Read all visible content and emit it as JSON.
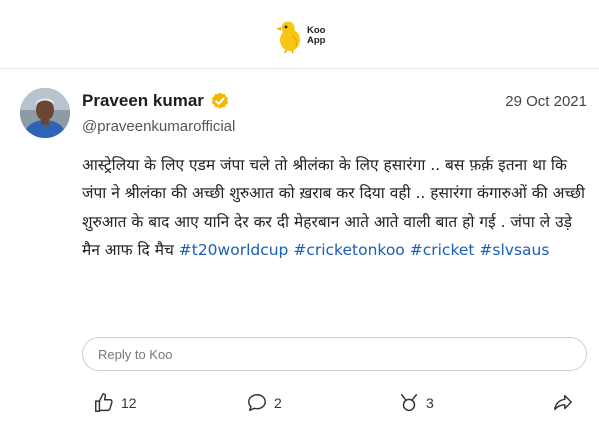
{
  "app": {
    "logo_line1": "Koo",
    "logo_line2": "App",
    "accent_yellow": "#F7C512"
  },
  "post": {
    "author_name": "Praveen kumar",
    "author_handle": "@praveenkumarofficial",
    "date": "29 Oct 2021",
    "verified_icon": "verified-badge-icon",
    "text_body": "आस्ट्रेलिया के लिए एडम जंपा चले तो श्रीलंका के लिए हसारंगा .. बस फ़र्क़ इतना था कि जंपा ने श्रीलंका की अच्छी शुरुआत को ख़राब कर दिया वही .. हसारंगा कंगारुओं की अच्छी शुरुआत के बाद आए यानि देर कर दी मेहरबान आते आते वाली बात हो गई . जंपा ले उड़े मैन आफ दि मैच",
    "hashtags": [
      "#t20worldcup",
      "#cricketonkoo",
      "#cricket",
      "#slvsaus"
    ],
    "hashtag_color": "#1a5fb4"
  },
  "reply": {
    "placeholder": "Reply to Koo"
  },
  "actions": {
    "like_count": "12",
    "comment_count": "2",
    "rekoo_count": "3"
  }
}
